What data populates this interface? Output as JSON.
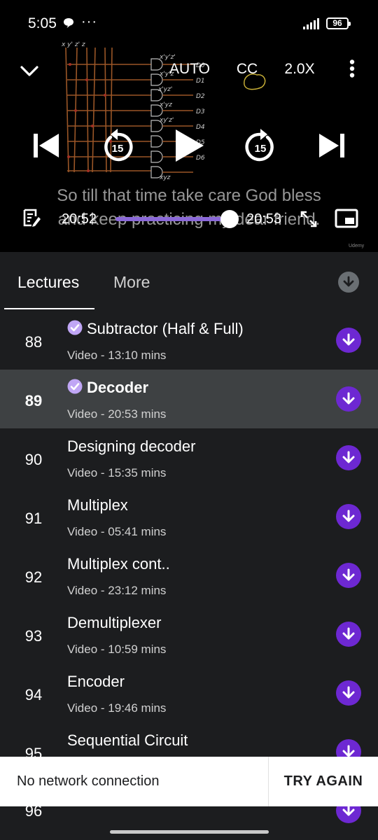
{
  "status_bar": {
    "time": "5:05",
    "more": "···",
    "battery": "96"
  },
  "player": {
    "quality": "AUTO",
    "captions": "CC",
    "speed": "2.0X",
    "rewind_seconds": "15",
    "forward_seconds": "15",
    "caption_line1": "So till that time take care God bless",
    "caption_line2": "and keep practicing my dear friend.",
    "current_time": "20:52",
    "duration": "20:53",
    "progress": 0.999,
    "watermark": "Udemy"
  },
  "tabs": {
    "lectures": "Lectures",
    "more": "More"
  },
  "lectures": [
    {
      "num": "88",
      "title": "Subtractor (Half & Full)",
      "meta": "Video - 13:10 mins",
      "completed": true,
      "active": false
    },
    {
      "num": "89",
      "title": "Decoder",
      "meta": "Video - 20:53 mins",
      "completed": true,
      "active": true
    },
    {
      "num": "90",
      "title": "Designing decoder",
      "meta": "Video - 15:35 mins",
      "completed": false,
      "active": false
    },
    {
      "num": "91",
      "title": "Multiplex",
      "meta": "Video - 05:41 mins",
      "completed": false,
      "active": false
    },
    {
      "num": "92",
      "title": "Multiplex cont..",
      "meta": "Video - 23:12 mins",
      "completed": false,
      "active": false
    },
    {
      "num": "93",
      "title": "Demultiplexer",
      "meta": "Video - 10:59 mins",
      "completed": false,
      "active": false
    },
    {
      "num": "94",
      "title": "Encoder",
      "meta": "Video - 19:46 mins",
      "completed": false,
      "active": false
    },
    {
      "num": "95",
      "title": "Sequential Circuit",
      "meta": "",
      "completed": false,
      "active": false
    }
  ],
  "partial_lecture": {
    "num": "96"
  },
  "snackbar": {
    "message": "No network connection",
    "action": "TRY AGAIN"
  },
  "colors": {
    "accent": "#6d28d2",
    "background": "#1c1d1f",
    "active_row": "#3e4143"
  }
}
